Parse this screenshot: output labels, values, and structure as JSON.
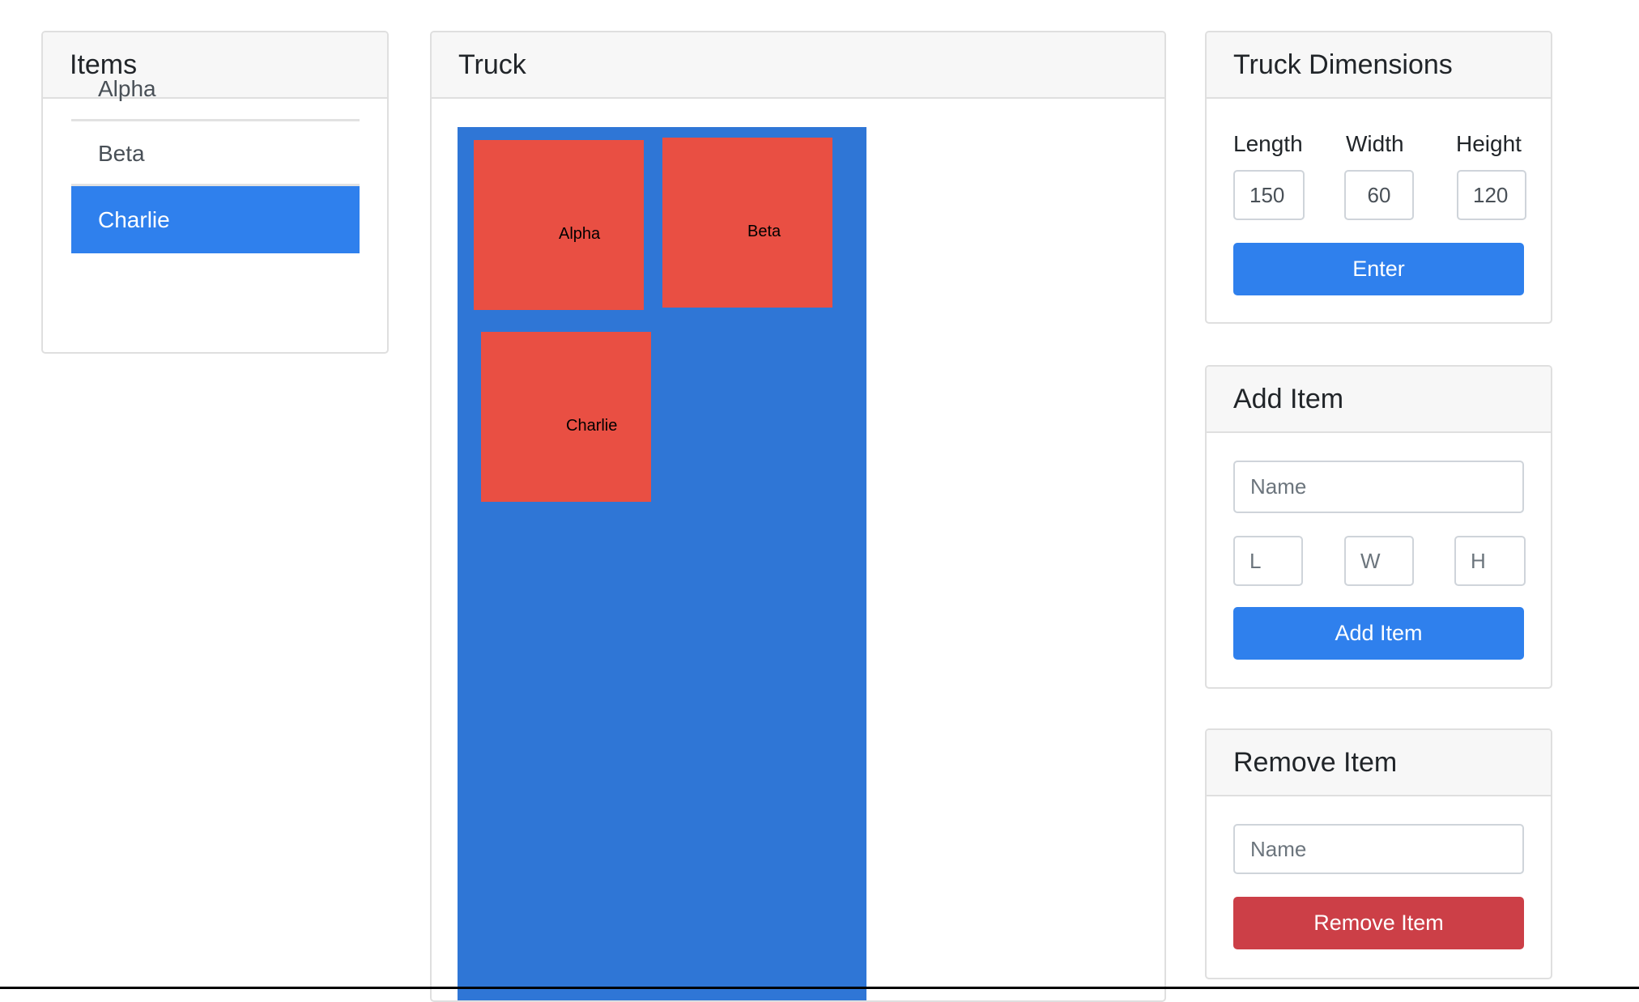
{
  "items_panel": {
    "title": "Items",
    "items": [
      {
        "label": "Alpha",
        "active": false
      },
      {
        "label": "Beta",
        "active": false
      },
      {
        "label": "Charlie",
        "active": true
      }
    ]
  },
  "truck_panel": {
    "title": "Truck",
    "boxes": [
      {
        "label": "Alpha"
      },
      {
        "label": "Beta"
      },
      {
        "label": "Charlie"
      }
    ]
  },
  "truck_dimensions": {
    "title": "Truck Dimensions",
    "length_label": "Length",
    "width_label": "Width",
    "height_label": "Height",
    "length_value": "150",
    "width_value": "60",
    "height_value": "120",
    "enter_label": "Enter"
  },
  "add_item": {
    "title": "Add Item",
    "name_placeholder": "Name",
    "l_placeholder": "L",
    "w_placeholder": "W",
    "h_placeholder": "H",
    "button_label": "Add Item"
  },
  "remove_item": {
    "title": "Remove Item",
    "name_placeholder": "Name",
    "button_label": "Remove Item"
  },
  "colors": {
    "primary": "#2f80ed",
    "truck": "#2f76d6",
    "box": "#e94f43",
    "danger": "#cc3f47"
  }
}
